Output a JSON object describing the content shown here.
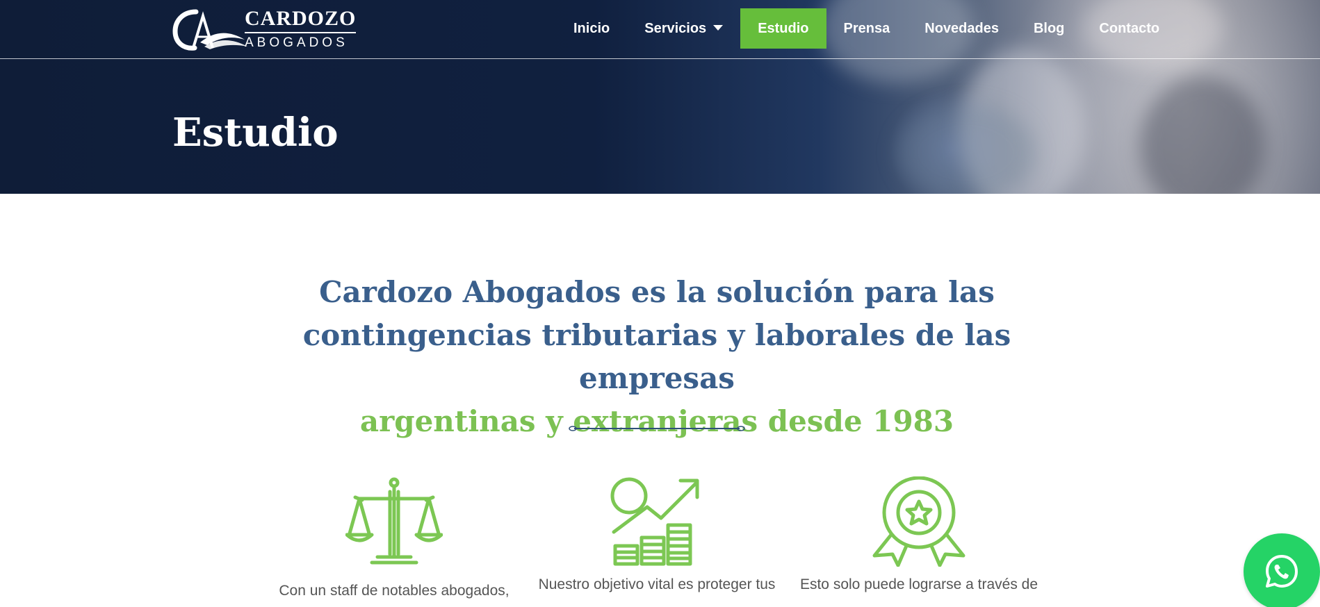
{
  "brand": {
    "name": "CARDOZO",
    "subtitle": "ABOGADOS",
    "logo_icon": "scales-swoosh-monogram",
    "logo_letters": "CA"
  },
  "nav": {
    "items": [
      {
        "label": "Inicio",
        "active": false
      },
      {
        "label": "Servicios",
        "active": false,
        "has_dropdown": true
      },
      {
        "label": "Estudio",
        "active": true
      },
      {
        "label": "Prensa",
        "active": false
      },
      {
        "label": "Novedades",
        "active": false
      },
      {
        "label": "Blog",
        "active": false
      },
      {
        "label": "Contacto",
        "active": false
      }
    ]
  },
  "hero": {
    "title": "Estudio"
  },
  "headline": {
    "line1": "Cardozo Abogados es la solución para las",
    "line2": "contingencias tributarias y laborales de las empresas",
    "line3_highlight": "argentinas y extranjeras desde 1983"
  },
  "features": [
    {
      "icon": "scales-of-justice-icon",
      "text": "Con un staff de notables abogados,"
    },
    {
      "icon": "growth-chart-icon",
      "text": "Nuestro objetivo vital es proteger tus"
    },
    {
      "icon": "award-badge-icon",
      "text": "Esto solo puede lograrse a través de"
    }
  ],
  "colors": {
    "accent_green": "#66be3b",
    "heading_blue": "#3a5f8c",
    "heading_green": "#7cc153",
    "icon_green": "#7cc753",
    "whatsapp_green": "#25d366"
  },
  "whatsapp": {
    "icon": "whatsapp-icon"
  }
}
